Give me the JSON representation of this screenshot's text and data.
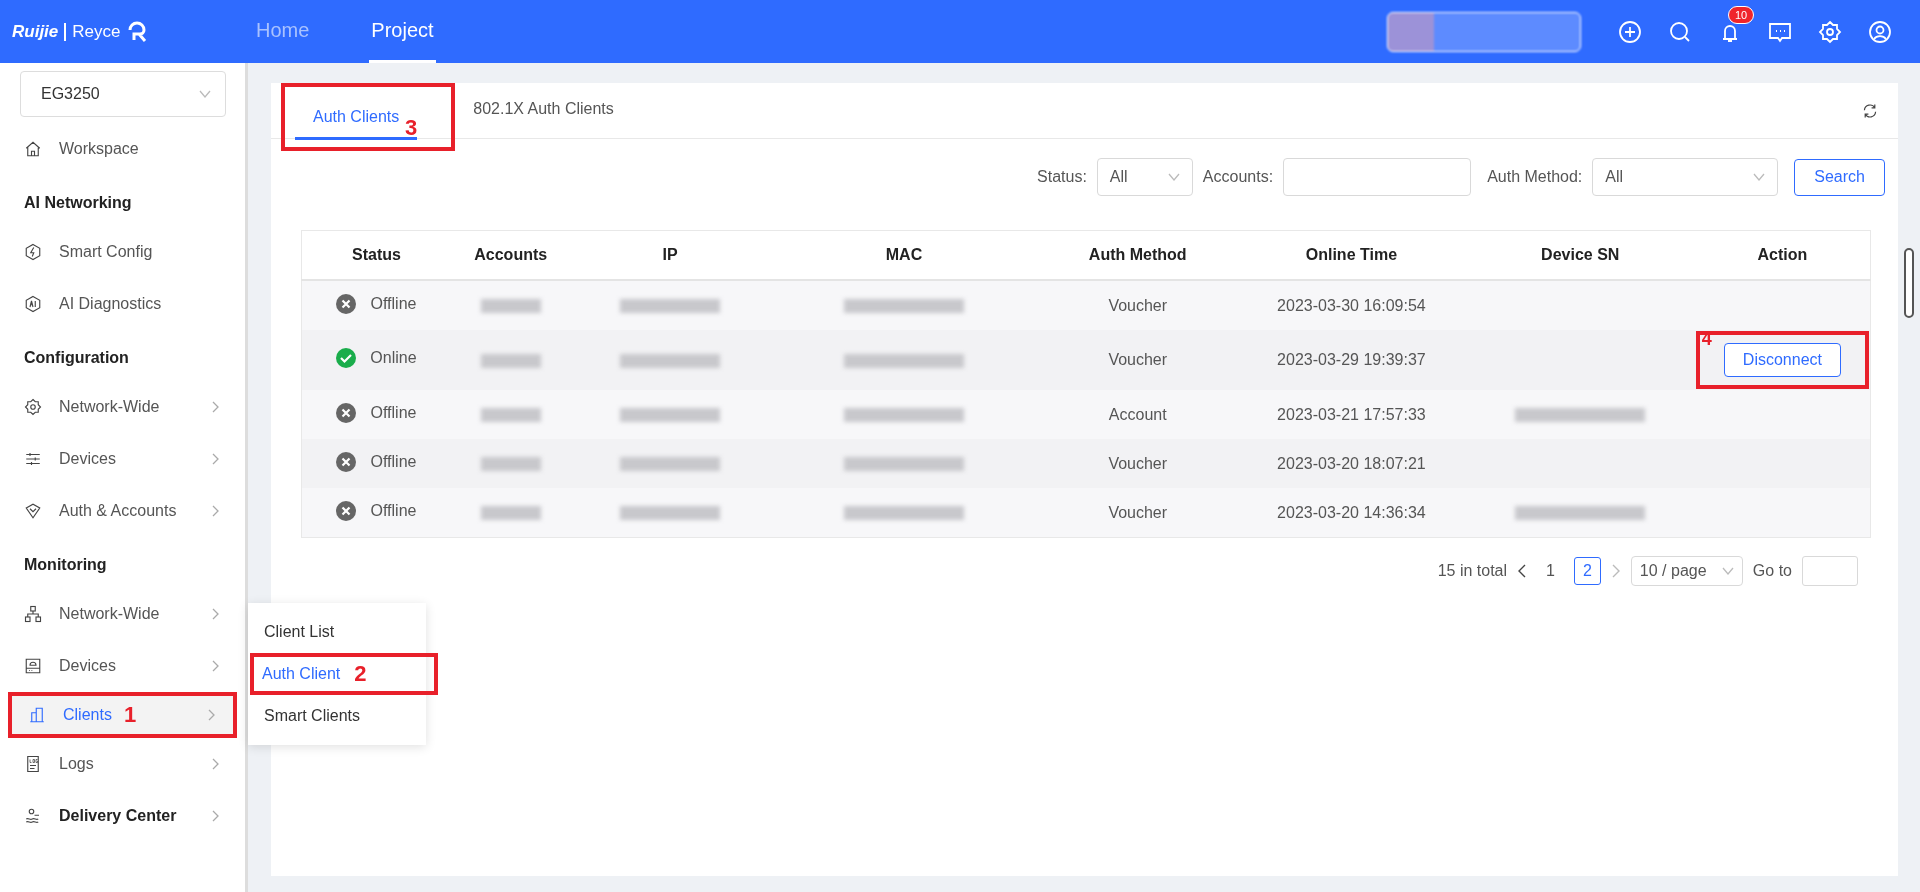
{
  "header": {
    "logo": {
      "brand": "Ruijie",
      "product": "Reyce"
    },
    "nav": [
      {
        "label": "Home",
        "selected": false
      },
      {
        "label": "Project",
        "selected": true
      }
    ],
    "notification_count": "10"
  },
  "sidebar": {
    "device_select": "EG3250",
    "groups": [
      {
        "items": [
          {
            "label": "Workspace",
            "kind": "plain",
            "has_arrow": false,
            "selected": false
          }
        ]
      },
      {
        "title": "AI Networking",
        "items": [
          {
            "label": "Smart Config",
            "kind": "plain",
            "has_arrow": false,
            "selected": false
          },
          {
            "label": "AI Diagnostics",
            "kind": "plain",
            "has_arrow": false,
            "selected": false
          }
        ]
      },
      {
        "title": "Configuration",
        "items": [
          {
            "label": "Network-Wide",
            "kind": "plain",
            "has_arrow": true,
            "selected": false
          },
          {
            "label": "Devices",
            "kind": "plain",
            "has_arrow": true,
            "selected": false
          },
          {
            "label": "Auth & Accounts",
            "kind": "plain",
            "has_arrow": true,
            "selected": false
          }
        ]
      },
      {
        "title": "Monitoring",
        "items": [
          {
            "label": "Network-Wide",
            "kind": "plain",
            "has_arrow": true,
            "selected": false
          },
          {
            "label": "Devices",
            "kind": "plain",
            "has_arrow": true,
            "selected": false
          },
          {
            "label": "Clients",
            "kind": "plain",
            "has_arrow": true,
            "selected": true,
            "callout": "1"
          },
          {
            "label": "Logs",
            "kind": "plain",
            "has_arrow": true,
            "selected": false
          }
        ]
      },
      {
        "items": [
          {
            "label": "Delivery Center",
            "kind": "bold",
            "has_arrow": true,
            "selected": false
          }
        ]
      }
    ]
  },
  "submenu": {
    "items": [
      {
        "label": "Client List",
        "selected": false
      },
      {
        "label": "Auth Client",
        "selected": true,
        "callout": "2"
      },
      {
        "label": "Smart Clients",
        "selected": false
      }
    ]
  },
  "tabs": [
    {
      "label": "Auth Clients",
      "selected": true,
      "callout": "3"
    },
    {
      "label": "802.1X Auth Clients",
      "selected": false
    }
  ],
  "filters": {
    "status_label": "Status:",
    "status_value": "All",
    "accounts_label": "Accounts:",
    "auth_method_label": "Auth Method:",
    "auth_method_value": "All",
    "search_button": "Search"
  },
  "table": {
    "columns": [
      "Status",
      "Accounts",
      "IP",
      "MAC",
      "Auth Method",
      "Online Time",
      "Device SN",
      "Action"
    ],
    "rows": [
      {
        "kind": "offline",
        "status_text": "Offline",
        "auth_method": "Voucher",
        "online_time": "2023-03-30 16:09:54",
        "device_sn_hidden": false
      },
      {
        "kind": "online",
        "status_text": "Online",
        "auth_method": "Voucher",
        "online_time": "2023-03-29 19:39:37",
        "device_sn_hidden": false,
        "action": "Disconnect",
        "callout": "4"
      },
      {
        "kind": "offline",
        "status_text": "Offline",
        "auth_method": "Account",
        "online_time": "2023-03-21 17:57:33",
        "device_sn_hidden": true
      },
      {
        "kind": "offline",
        "status_text": "Offline",
        "auth_method": "Voucher",
        "online_time": "2023-03-20 18:07:21",
        "device_sn_hidden": false
      },
      {
        "kind": "offline",
        "status_text": "Offline",
        "auth_method": "Voucher",
        "online_time": "2023-03-20 14:36:34",
        "device_sn_hidden": true
      }
    ]
  },
  "pagination": {
    "total": "15 in total",
    "pages": [
      {
        "label": "1",
        "selected": false
      },
      {
        "label": "2",
        "selected": true
      }
    ],
    "page_size": "10 / page",
    "goto_label": "Go to"
  }
}
